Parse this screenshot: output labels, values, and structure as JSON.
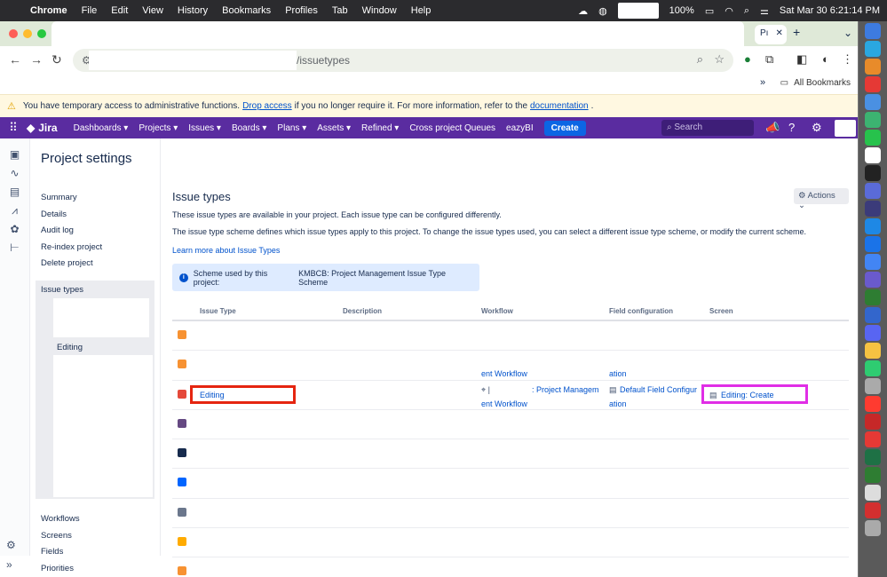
{
  "menubar": {
    "app": "Chrome",
    "items": [
      "File",
      "Edit",
      "View",
      "History",
      "Bookmarks",
      "Profiles",
      "Tab",
      "Window",
      "Help"
    ],
    "battery": "100%",
    "datetime": "Sat Mar 30  6:21:14 PM"
  },
  "browser": {
    "tab2_label": "Pı",
    "url_fragment": "/issuetypes",
    "bookmarks_label": "All Bookmarks"
  },
  "banner": {
    "prefix": "You have temporary access to administrative functions.",
    "link1": "Drop access",
    "middle": "if you no longer require it. For more information, refer to the",
    "link2": "documentation",
    "suffix": "."
  },
  "jira": {
    "logo": "Jira",
    "nav": [
      "Dashboards ▾",
      "Projects ▾",
      "Issues ▾",
      "Boards ▾",
      "Plans ▾",
      "Assets ▾",
      "Refined ▾",
      "Cross project Queues",
      "eazyBI"
    ],
    "create": "Create",
    "search_placeholder": "Search"
  },
  "sidebar": {
    "title": "Project settings",
    "items": [
      "Summary",
      "Details",
      "Audit log",
      "Re-index project",
      "Delete project"
    ],
    "active_label": "Issue types",
    "active_sub": "Editing",
    "items2": [
      "Workflows",
      "Screens",
      "Fields",
      "Priorities"
    ]
  },
  "main": {
    "heading": "Issue types",
    "actions": "Actions",
    "desc1": "These issue types are available in your project. Each issue type can be configured differently.",
    "desc2": "The issue type scheme defines which issue types apply to this project. To change the issue types used, you can select a different issue type scheme, or modify the current scheme.",
    "learn_more": "Learn more about Issue Types",
    "scheme_label": "Scheme used by this project:",
    "scheme_name": "KMBCB: Project Management Issue Type Scheme",
    "columns": [
      "Issue Type",
      "Description",
      "Workflow",
      "Field configuration",
      "Screen"
    ],
    "rows": [
      {
        "icon_color": "#f79232",
        "name": "",
        "workflow": "",
        "workflow2": "",
        "field": "",
        "field2": "",
        "screen": ""
      },
      {
        "icon_color": "#f79232",
        "name": "",
        "workflow": "",
        "workflow2": "ent Workflow",
        "field": "",
        "field2": "ation",
        "screen": ""
      },
      {
        "icon_color": "#e5493a",
        "name": "Editing",
        "workflow": ": Project Managem",
        "workflow2": "ent Workflow",
        "field": "Default Field Configur",
        "field2": "ation",
        "screen": "Editing: Create"
      },
      {
        "icon_color": "#654982",
        "name": "",
        "workflow": "",
        "workflow2": "",
        "field": "",
        "field2": "",
        "screen": ""
      },
      {
        "icon_color": "#172b4d",
        "name": "",
        "workflow": "",
        "workflow2": "",
        "field": "",
        "field2": "",
        "screen": ""
      },
      {
        "icon_color": "#0065ff",
        "name": "",
        "workflow": "",
        "workflow2": "",
        "field": "",
        "field2": "",
        "screen": ""
      },
      {
        "icon_color": "#6b778c",
        "name": "",
        "workflow": "",
        "workflow2": "",
        "field": "",
        "field2": "",
        "screen": ""
      },
      {
        "icon_color": "#ffab00",
        "name": "",
        "workflow": "",
        "workflow2": "",
        "field": "",
        "field2": "",
        "screen": ""
      },
      {
        "icon_color": "#f79232",
        "name": "",
        "workflow": "",
        "workflow2": "",
        "field": "",
        "field2": "",
        "screen": ""
      }
    ]
  },
  "colors": {
    "jira_nav": "#5a2ca0",
    "highlight_red": "#e52510",
    "highlight_magenta": "#e02ee6",
    "link": "#0052cc"
  }
}
